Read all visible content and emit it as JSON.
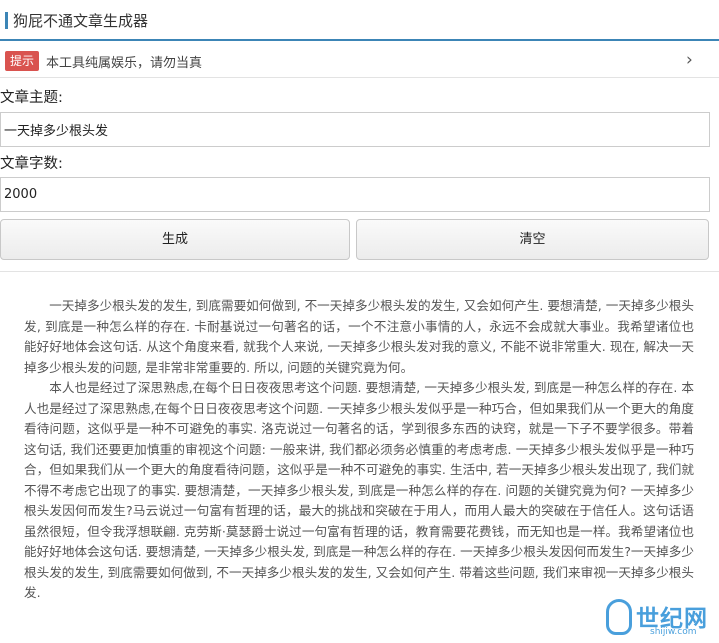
{
  "header": {
    "title": "狗屁不通文章生成器"
  },
  "notice": {
    "badge": "提示",
    "text": "本工具纯属娱乐，请勿当真",
    "chevron": "›"
  },
  "form": {
    "topic_label": "文章主题:",
    "topic_value": "一天掉多少根头发",
    "count_label": "文章字数:",
    "count_value": "2000",
    "generate_label": "生成",
    "clear_label": "清空"
  },
  "article": {
    "paragraphs": [
      "一天掉多少根头发的发生, 到底需要如何做到, 不一天掉多少根头发的发生, 又会如何产生. 要想清楚, 一天掉多少根头发, 到底是一种怎么样的存在. 卡耐基说过一句著名的话，一个不注意小事情的人，永远不会成就大事业。我希望诸位也能好好地体会这句话. 从这个角度来看, 就我个人来说, 一天掉多少根头发对我的意义, 不能不说非常重大. 现在, 解决一天掉多少根头发的问题, 是非常非常重要的. 所以, 问题的关键究竟为何。",
      "本人也是经过了深思熟虑,在每个日日夜夜思考这个问题. 要想清楚, 一天掉多少根头发, 到底是一种怎么样的存在. 本人也是经过了深思熟虑,在每个日日夜夜思考这个问题. 一天掉多少根头发似乎是一种巧合，但如果我们从一个更大的角度看待问题，这似乎是一种不可避免的事实. 洛克说过一句著名的话，学到很多东西的诀窍，就是一下子不要学很多。带着这句话, 我们还要更加慎重的审视这个问题: 一般来讲, 我们都必须务必慎重的考虑考虑. 一天掉多少根头发似乎是一种巧合，但如果我们从一个更大的角度看待问题，这似乎是一种不可避免的事实. 生活中, 若一天掉多少根头发出现了, 我们就不得不考虑它出现了的事实. 要想清楚，一天掉多少根头发, 到底是一种怎么样的存在. 问题的关键究竟为何? 一天掉多少根头发因何而发生?马云说过一句富有哲理的话，最大的挑战和突破在于用人，而用人最大的突破在于信任人。这句话语虽然很短，但令我浮想联翩. 克劳斯·莫瑟爵士说过一句富有哲理的话，教育需要花费钱，而无知也是一样。我希望诸位也能好好地体会这句话. 要想清楚, 一天掉多少根头发, 到底是一种怎么样的存在. 一天掉多少根头发因何而发生?一天掉多少根头发的发生, 到底需要如何做到, 不一天掉多少根头发的发生, 又会如何产生. 带着这些问题, 我们来审视一天掉多少根头发."
    ]
  },
  "watermark": {
    "text": "世纪网",
    "sub": "shijiw.com"
  }
}
